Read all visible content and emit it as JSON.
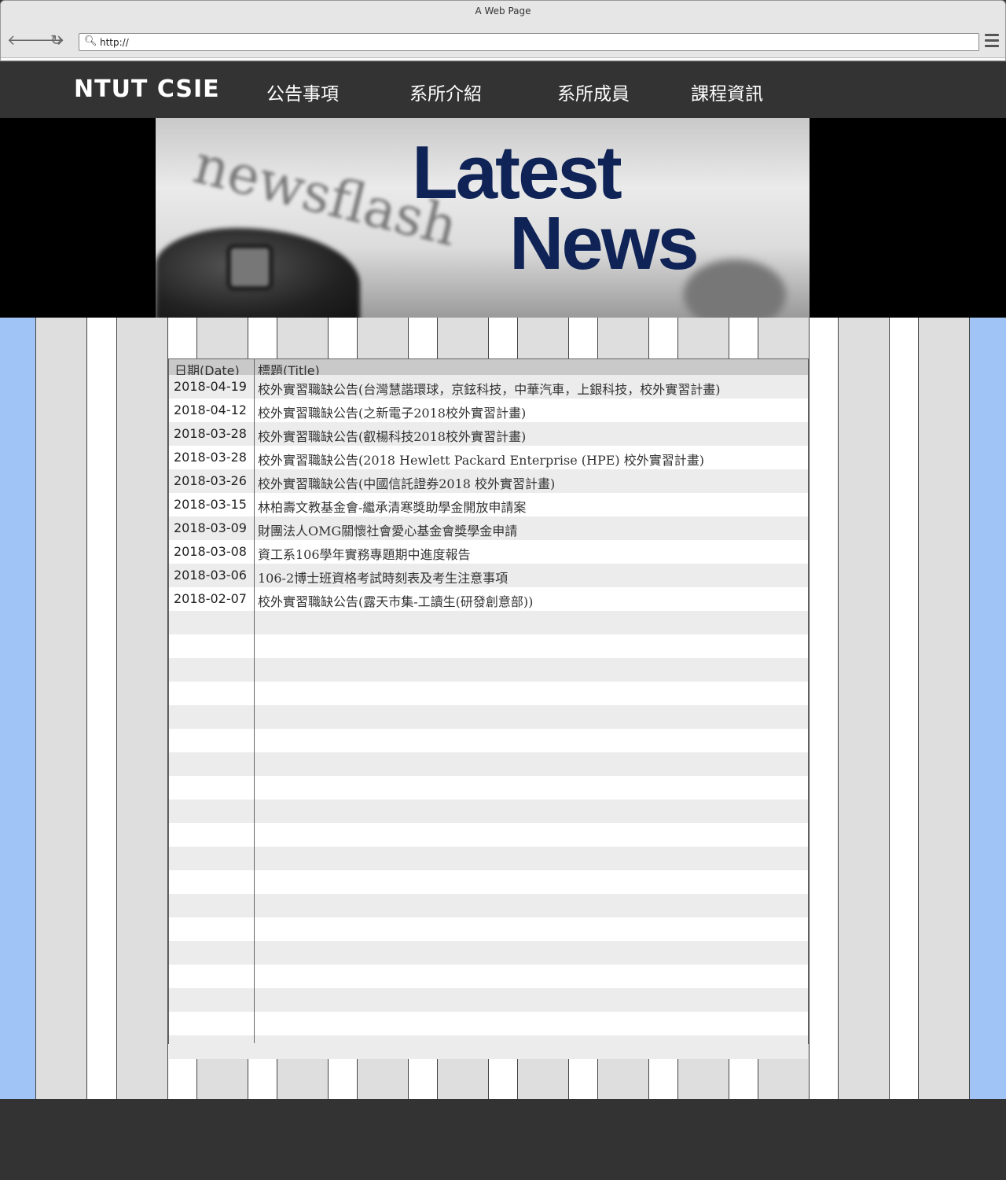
{
  "browser": {
    "window_title": "A Web Page",
    "url": "http://",
    "back_icon": "arrow-left-icon",
    "forward_icon": "arrow-right-icon",
    "reload_icon": "reload-icon",
    "search_icon": "magnifier-icon",
    "menu_icon": "hamburger-icon"
  },
  "header": {
    "brand": "NTUT CSIE",
    "nav": [
      "公告事項",
      "系所介紹",
      "系所成員",
      "課程資訊"
    ]
  },
  "banner": {
    "title_line1": "Latest",
    "title_line2": "News",
    "background_word": "newsflash"
  },
  "table": {
    "headers": {
      "date": "日期(Date)",
      "title": "標題(Title)"
    },
    "rows": [
      {
        "date": "2018-04-19",
        "title": "校外實習職缺公告(台灣慧諧環球，京鉉科技，中華汽車，上銀科技，校外實習計畫)"
      },
      {
        "date": "2018-04-12",
        "title": "校外實習職缺公告(之新電子2018校外實習計畫)"
      },
      {
        "date": "2018-03-28",
        "title": "校外實習職缺公告(叡楊科技2018校外實習計畫)"
      },
      {
        "date": "2018-03-28",
        "title": "校外實習職缺公告(2018 Hewlett Packard Enterprise (HPE) 校外實習計畫)"
      },
      {
        "date": "2018-03-26",
        "title": "校外實習職缺公告(中國信託證券2018 校外實習計畫)"
      },
      {
        "date": "2018-03-15",
        "title": "林柏壽文教基金會-繼承清寒獎助學金開放申請案"
      },
      {
        "date": "2018-03-09",
        "title": "財團法人OMG關懷社會愛心基金會獎學金申請"
      },
      {
        "date": "2018-03-08",
        "title": "資工系106學年實務專題期中進度報告"
      },
      {
        "date": "2018-03-06",
        "title": "106-2博士班資格考試時刻表及考生注意事項"
      },
      {
        "date": "2018-02-07",
        "title": "校外實習職缺公告(露天市集-工讀生(研發創意部))"
      }
    ],
    "empty_rows": 19
  },
  "colors": {
    "header_bg": "#333333",
    "banner_title": "#0f2356",
    "grid_blue": "#a0c4f5",
    "grid_gray": "#dedede",
    "row_alt": "#ececec",
    "table_header": "#c9c9c9"
  }
}
